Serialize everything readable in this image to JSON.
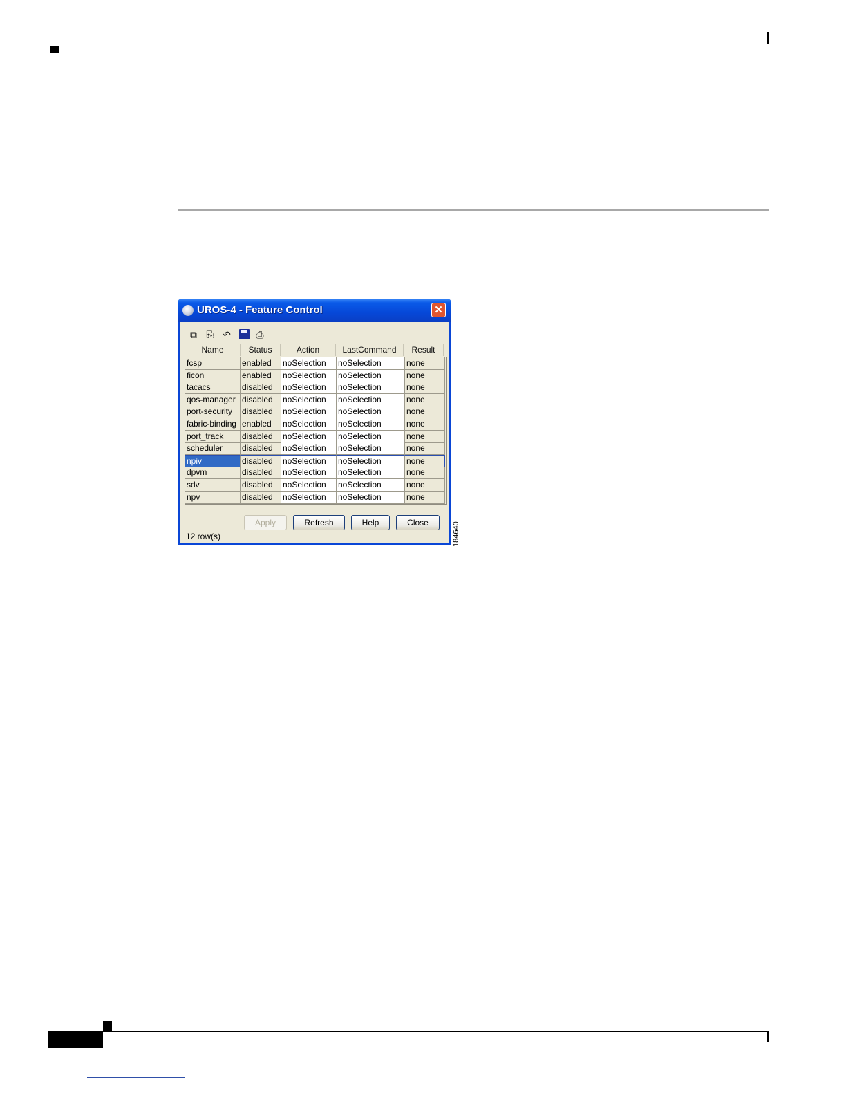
{
  "window": {
    "title": "UROS-4 - Feature Control",
    "close_glyph": "✕",
    "toolbar_icons": [
      "copy-icon",
      "paste-icon",
      "undo-icon",
      "save-icon",
      "print-icon"
    ]
  },
  "table": {
    "columns": [
      "Name",
      "Status",
      "Action",
      "LastCommand",
      "Result"
    ],
    "rows": [
      {
        "name": "fcsp",
        "status": "enabled",
        "action": "noSelection",
        "last": "noSelection",
        "result": "none"
      },
      {
        "name": "ficon",
        "status": "enabled",
        "action": "noSelection",
        "last": "noSelection",
        "result": "none"
      },
      {
        "name": "tacacs",
        "status": "disabled",
        "action": "noSelection",
        "last": "noSelection",
        "result": "none"
      },
      {
        "name": "qos-manager",
        "status": "disabled",
        "action": "noSelection",
        "last": "noSelection",
        "result": "none"
      },
      {
        "name": "port-security",
        "status": "disabled",
        "action": "noSelection",
        "last": "noSelection",
        "result": "none"
      },
      {
        "name": "fabric-binding",
        "status": "enabled",
        "action": "noSelection",
        "last": "noSelection",
        "result": "none"
      },
      {
        "name": "port_track",
        "status": "disabled",
        "action": "noSelection",
        "last": "noSelection",
        "result": "none"
      },
      {
        "name": "scheduler",
        "status": "disabled",
        "action": "noSelection",
        "last": "noSelection",
        "result": "none"
      },
      {
        "name": "npiv",
        "status": "disabled",
        "action": "noSelection",
        "last": "noSelection",
        "result": "none"
      },
      {
        "name": "dpvm",
        "status": "disabled",
        "action": "noSelection",
        "last": "noSelection",
        "result": "none"
      },
      {
        "name": "sdv",
        "status": "disabled",
        "action": "noSelection",
        "last": "noSelection",
        "result": "none"
      },
      {
        "name": "npv",
        "status": "disabled",
        "action": "noSelection",
        "last": "noSelection",
        "result": "none"
      }
    ],
    "selected_row": "npiv"
  },
  "buttons": {
    "apply": "Apply",
    "refresh": "Refresh",
    "help": "Help",
    "close": "Close"
  },
  "status": {
    "row_count": "12 row(s)"
  },
  "figure_id": "184640",
  "colors": {
    "titlebar": "#0a46d6",
    "selection": "#316ac5",
    "dialog_bg": "#ece9d8"
  }
}
